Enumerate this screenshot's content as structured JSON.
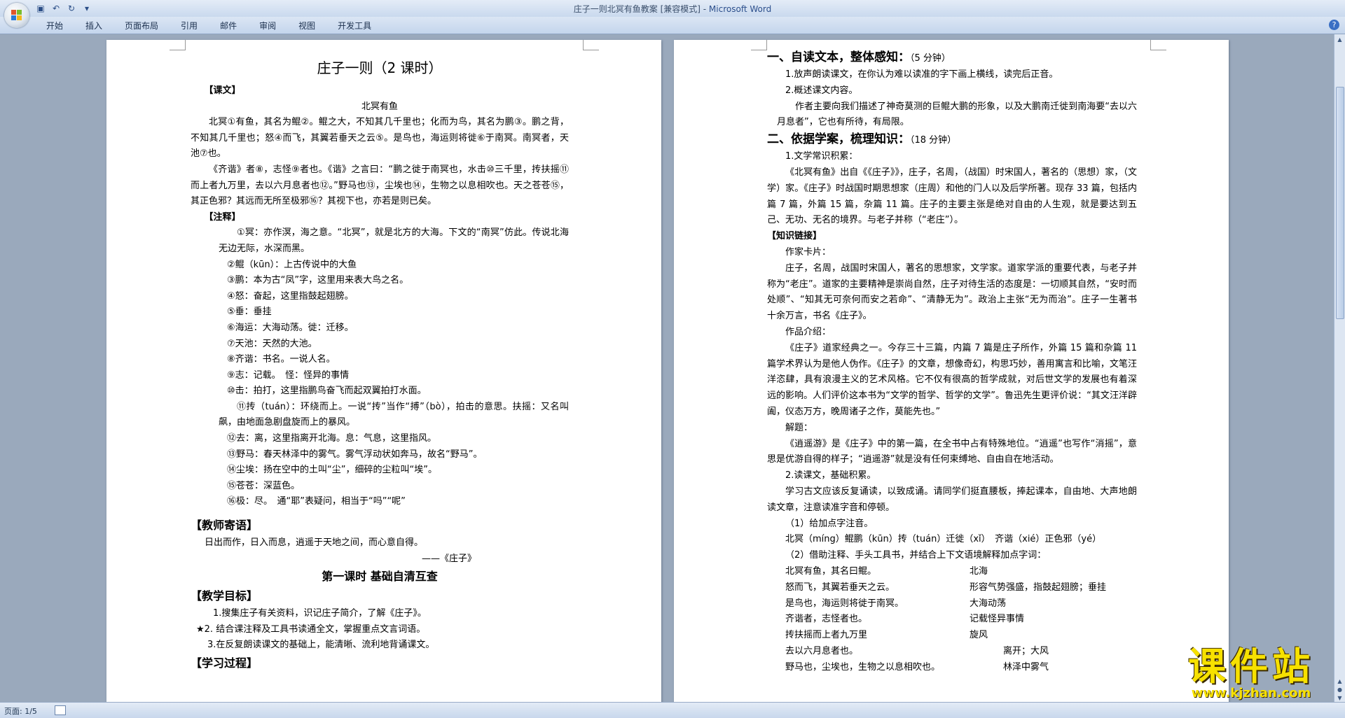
{
  "window": {
    "title": "庄子一则北冥有鱼教案 [兼容模式] - ",
    "app": "Microsoft Word"
  },
  "ribbon": {
    "tabs": [
      "开始",
      "插入",
      "页面布局",
      "引用",
      "邮件",
      "审阅",
      "视图",
      "开发工具"
    ]
  },
  "status": {
    "page": "页面: 1/5"
  },
  "watermark": {
    "main": "课件站",
    "url": "www.kjzhan.com"
  },
  "page1": {
    "title": "庄子一则（2 课时）",
    "kewen_label": "【课文】",
    "poem_title": "北冥有鱼",
    "paragraphs": [
      "北冥①有鱼，其名为鲲②。鲲之大，不知其几千里也；化而为鸟，其名为鹏③。鹏之背，不知其几千里也；怒④而飞，其翼若垂天之云⑤。是鸟也，海运则将徙⑥于南冥。南冥者，天池⑦也。",
      "《齐谐》者⑧，志怪⑨者也。《谐》之言曰：“鹏之徙于南冥也，水击⑩三千里，抟扶摇⑪而上者九万里，去以六月息者也⑫。”野马也⑬，尘埃也⑭，生物之以息相吹也。天之苍苍⑮，其正色邪？其远而无所至极邪⑯？其视下也，亦若是则已矣。"
    ],
    "notes_label": "【注释】",
    "note1": "①冥：亦作溟，海之意。“北冥”，就是北方的大海。下文的“南冥”仿此。传说北海无边无际，水深而黑。",
    "notes": [
      "②鲲（kūn）：上古传说中的大鱼",
      "③鹏：本为古“凤”字，这里用来表大鸟之名。",
      "④怒：奋起，这里指鼓起翅膀。",
      "⑤垂：垂挂",
      "⑥海运：大海动荡。徙：迁移。",
      "⑦天池：天然的大池。",
      "⑧齐谐：书名。一说人名。",
      "⑨志：记载。　怪：怪异的事情",
      "⑩击：拍打，这里指鹏鸟奋飞而起双翼拍打水面。"
    ],
    "note11": "⑪抟（tuán）：环绕而上。一说“抟”当作“搏”（bò），拍击的意思。扶摇：又名叫飙，由地面急剧盘旋而上的暴风。",
    "notes_b": [
      "⑫去：离，这里指离开北海。息：气息，这里指风。",
      "⑬野马：春天林泽中的雾气。雾气浮动状如奔马，故名“野马”。",
      "⑭尘埃：扬在空中的土叫“尘”，细碎的尘粒叫“埃”。",
      "⑮苍苍：深蓝色。",
      "⑯极：尽。　通“耶”表疑问，相当于“吗”“呢”"
    ],
    "teacher_heading": "【教师寄语】",
    "teacher_text": "日出而作，日入而息，逍遥于天地之间，而心意自得。",
    "teacher_src": "——《庄子》",
    "lesson1_title": "第一课时  基础自清互查",
    "goals_heading": "【教学目标】",
    "goals": [
      "1.搜集庄子有关资料，识记庄子简介，了解《庄子》。",
      "★2.  结合课注释及工具书读通全文，掌握重点文言词语。",
      "3.在反复朗读课文的基础上，能清晰、流利地背诵课文。"
    ],
    "process_heading": "【学习过程】"
  },
  "page2": {
    "s1_heading": "一、自读文本，整体感知：",
    "s1_time": "（5 分钟）",
    "s1_items": [
      "1.放声朗读课文，在你认为难以读准的字下画上横线，读完后正音。",
      "2.概述课文内容。"
    ],
    "s1_para": "作者主要向我们描述了神奇莫测的巨鲲大鹏的形象，以及大鹏南迁徙到南海要“去以六月息者”，它也有所待，有局限。",
    "s2_heading": "二、依据学案，梳理知识：",
    "s2_time": "（18 分钟）",
    "lit_label": "1.文学常识积累：",
    "lit_para": "《北冥有鱼》出自《《庄子》》，庄子，名周，（战国）时宋国人，著名的（思想）家，（文学）家。《庄子》时战国时期思想家（庄周）和他的门人以及后学所著。现存 33 篇，包括内篇 7 篇，外篇 15 篇，杂篇 11 篇。庄子的主要主张是绝对自由的人生观，就是要达到五己、无功、无名的境界。与老子并称（“老庄”）。",
    "link_label": "【知识链接】",
    "card_label": "作家卡片：",
    "card_para": "庄子，名周，战国时宋国人，著名的思想家，文学家。道家学派的重要代表，与老子并称为“老庄”。道家的主要精神是崇尚自然，庄子对待生活的态度是：一切顺其自然，“安时而处顺”、“知其无可奈何而安之若命”、“清静无为”。政治上主张“无为而治”。庄子一生著书十余万言，书名《庄子》。",
    "work_label": "作品介绍：",
    "work_para": "《庄子》道家经典之一。今存三十三篇，内篇 7 篇是庄子所作，外篇 15 篇和杂篇 11 篇学术界认为是他人伪作。《庄子》的文章，想像奇幻，构思巧妙，善用寓言和比喻，文笔汪洋恣肆，具有浪漫主义的艺术风格。它不仅有很高的哲学成就，对后世文学的发展也有着深远的影响。人们评价这本书为“文学的哲学、哲学的文学”。鲁迅先生更评价说：“其文汪洋辟阖，仪态万方，晚周诸子之作，莫能先也。”",
    "title_label": "解题：",
    "title_para": "《逍遥游》是《庄子》中的第一篇，在全书中占有特殊地位。“逍遥”也写作“消摇”，意思是优游自得的样子；“逍遥游”就是没有任何束缚地、自由自在地活动。",
    "read_label": "2.读课文，基础积累。",
    "read_para": "学习古文应该反复诵读，以致成诵。请同学们挺直腰板，捧起课本，自由地、大声地朗读文章，注意读准字音和停顿。",
    "q1_label": "（1）给加点字注音。",
    "q1_line": "北冥（míng）鲲鹏（kūn）抟（tuán）迁徙（xǐ）　齐谐（xié）正色邪（yé）",
    "q2_label": "（2）借助注释、手头工具书，并结合上下文语境解释加点字词：",
    "pairs": [
      {
        "l": "北冥有鱼，其名曰鲲。",
        "r": "北海"
      },
      {
        "l": "怒而飞，其翼若垂天之云。",
        "r": "形容气势强盛，指鼓起翅膀；垂挂"
      },
      {
        "l": "是鸟也，海运则将徙于南冥。",
        "r": "大海动荡"
      },
      {
        "l": "齐谐者，志怪者也。",
        "r": "记载怪异事情"
      },
      {
        "l": "抟扶摇而上者九万里",
        "r": "旋风"
      }
    ],
    "pairs2": [
      {
        "l": "去以六月息者也。",
        "r": "离开；大风"
      },
      {
        "l": "野马也，尘埃也，生物之以息相吹也。",
        "r": "林泽中雾气"
      }
    ]
  }
}
